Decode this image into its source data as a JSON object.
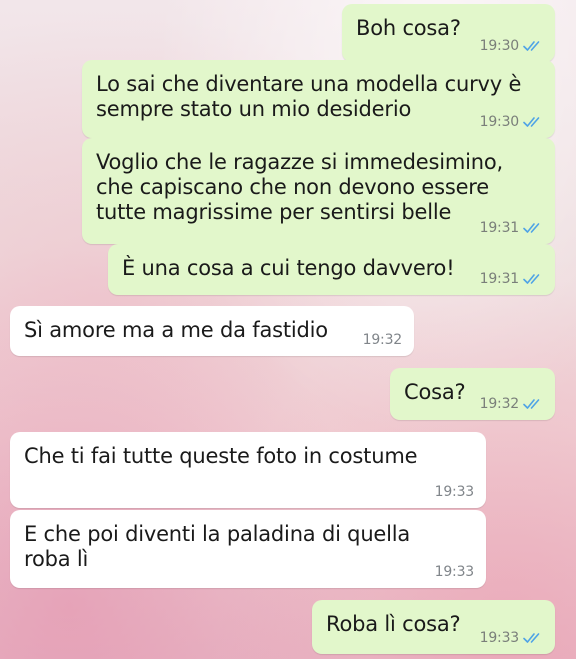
{
  "colors": {
    "outgoing_bubble": "#e2f7cb",
    "incoming_bubble": "#ffffff",
    "read_ticks": "#4fa3e6",
    "timestamp": "#7a7f7a"
  },
  "messages": [
    {
      "direction": "outgoing",
      "text": "Boh cosa?",
      "time": "19:30",
      "status_icon": "double-check-read-icon"
    },
    {
      "direction": "outgoing",
      "text": "Lo sai che diventare una modella curvy è\nsempre stato un mio desiderio",
      "time": "19:30",
      "status_icon": "double-check-read-icon"
    },
    {
      "direction": "outgoing",
      "text": "Voglio che le ragazze si immedesimino,\nche capiscano che non devono essere\ntutte magrissime per sentirsi belle",
      "time": "19:31",
      "status_icon": "double-check-read-icon"
    },
    {
      "direction": "outgoing",
      "text": "È una cosa a cui tengo davvero!",
      "time": "19:31",
      "status_icon": "double-check-read-icon"
    },
    {
      "direction": "incoming",
      "text": "Sì amore ma a me da fastidio",
      "time": "19:32"
    },
    {
      "direction": "outgoing",
      "text": "Cosa?",
      "time": "19:32",
      "status_icon": "double-check-read-icon"
    },
    {
      "direction": "incoming",
      "text": "Che ti fai tutte queste foto in costume",
      "time": "19:33"
    },
    {
      "direction": "incoming",
      "text": "E che poi diventi la paladina di quella\nroba lì",
      "time": "19:33"
    },
    {
      "direction": "outgoing",
      "text": "Roba lì cosa?",
      "time": "19:33",
      "status_icon": "double-check-read-icon"
    }
  ]
}
